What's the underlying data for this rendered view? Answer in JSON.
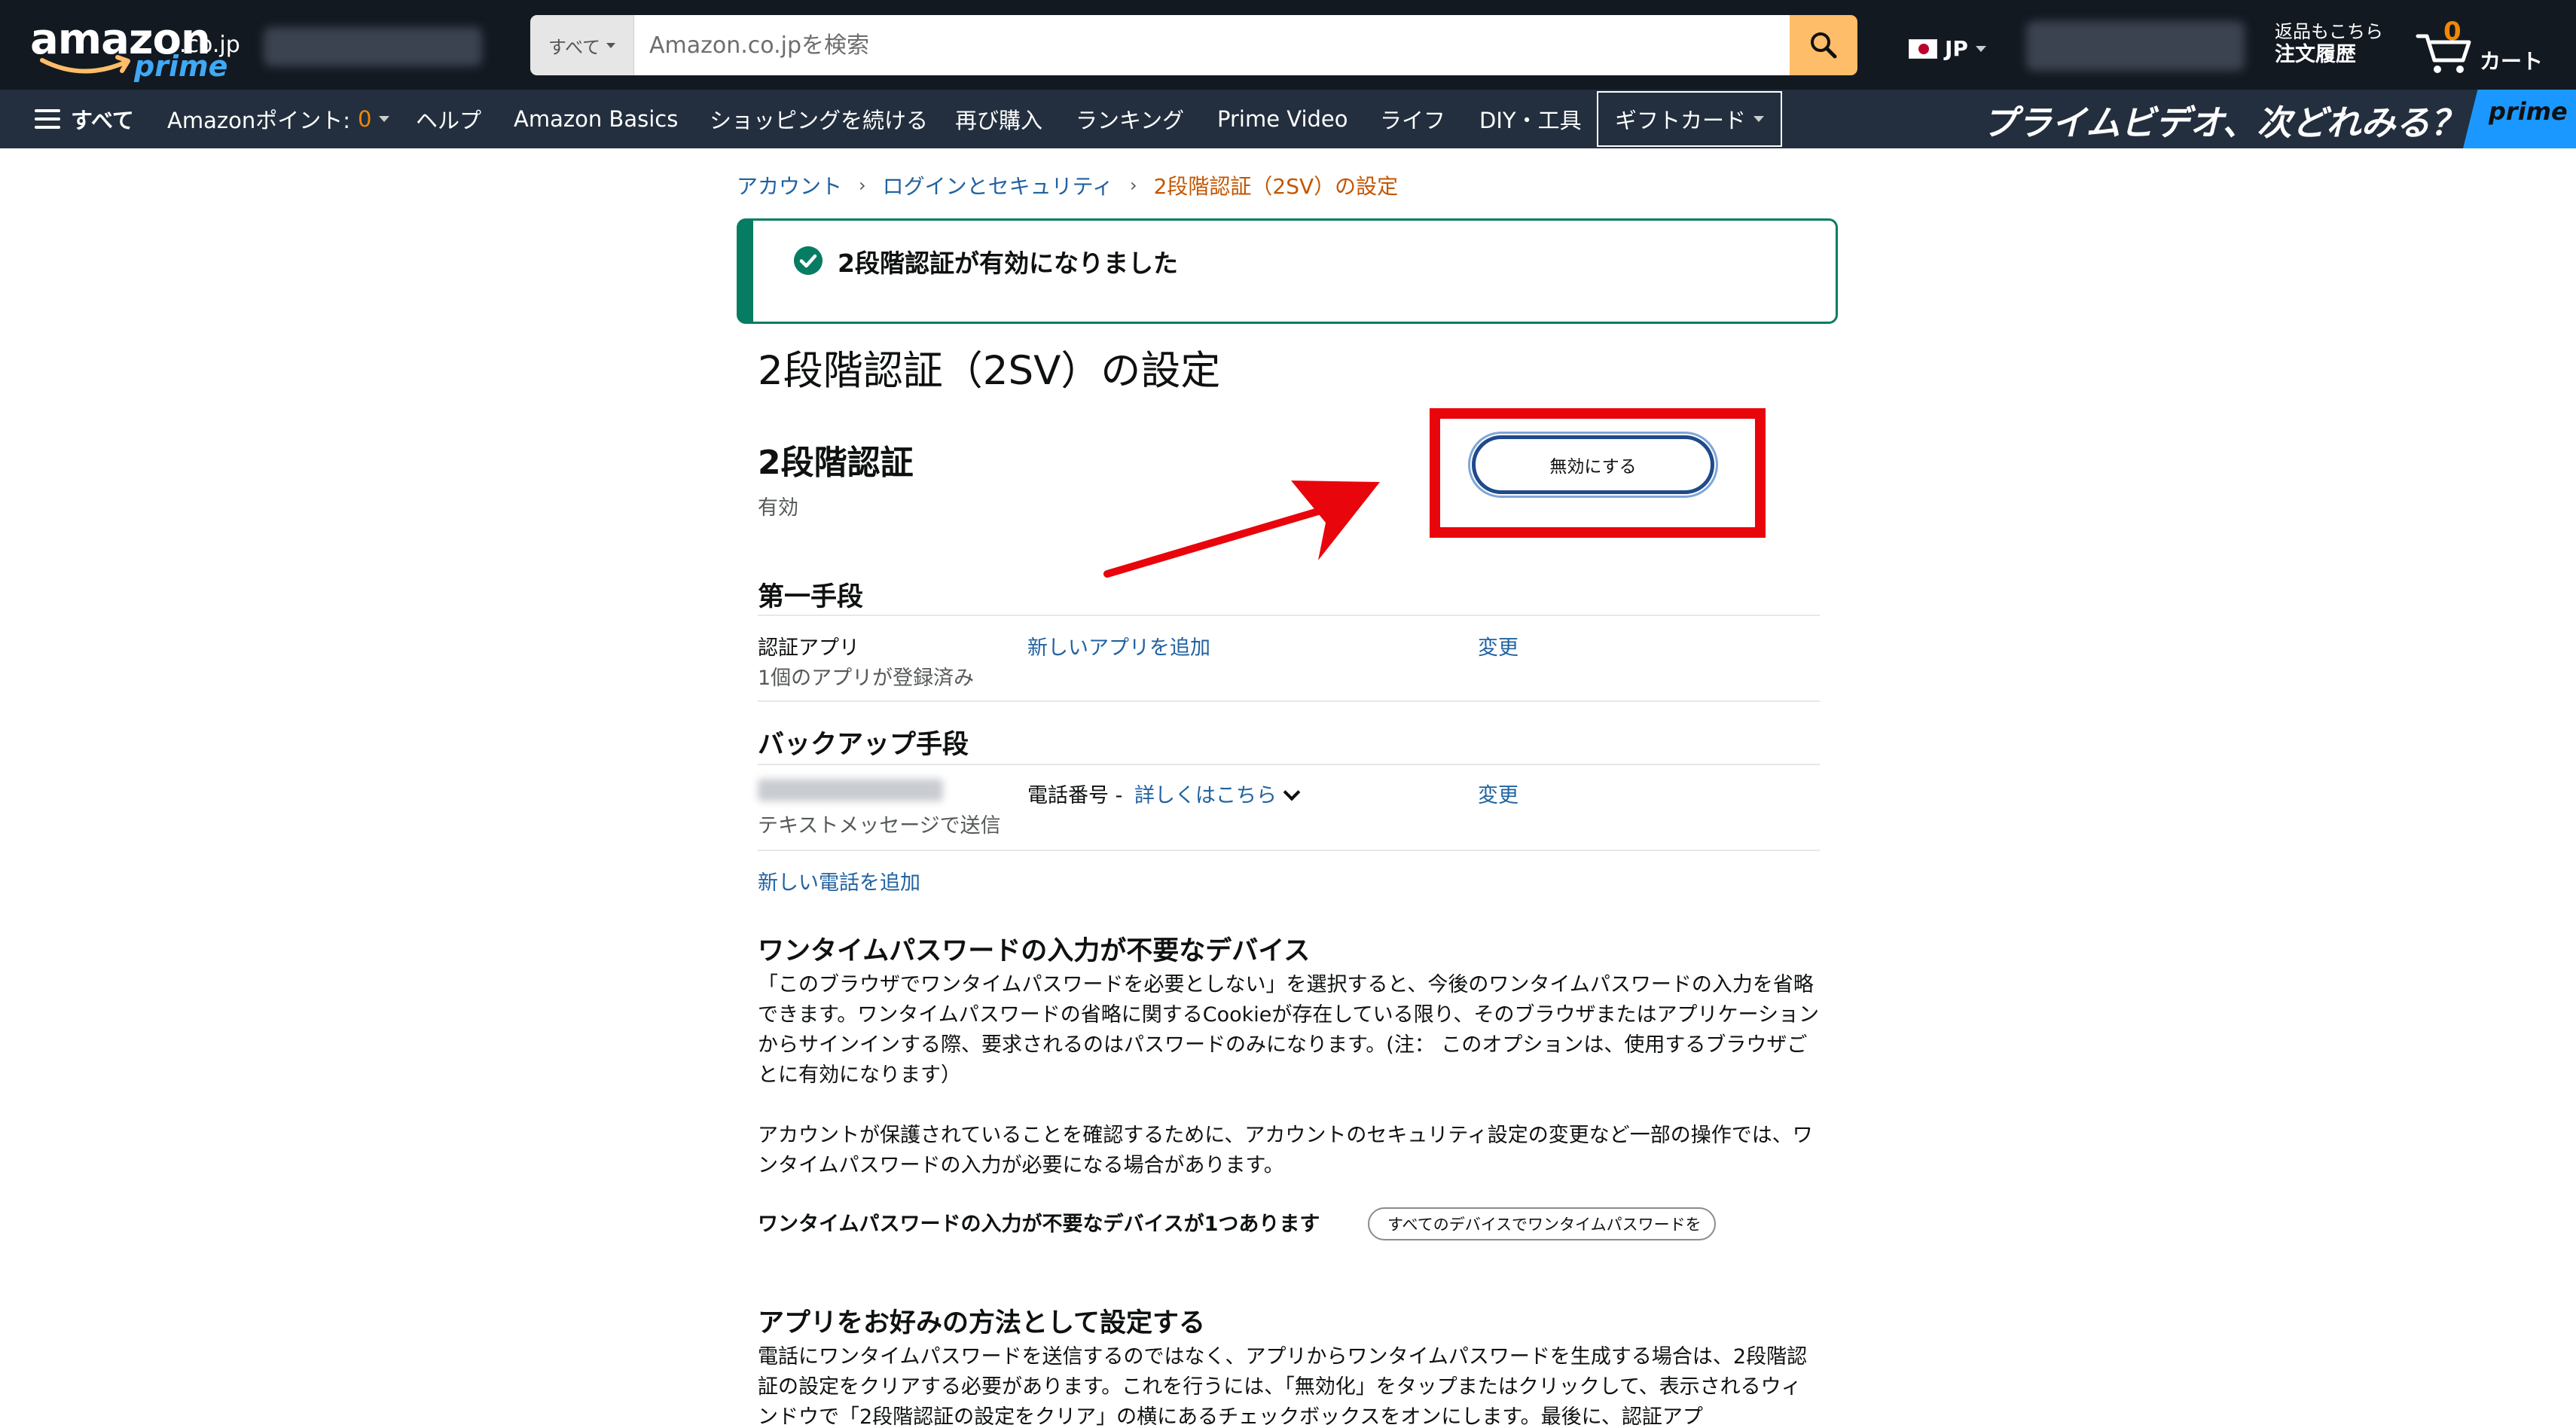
{
  "header": {
    "logo_text": "amazon",
    "logo_tld": ".co.jp",
    "logo_prime": "prime",
    "search_category": "すべて",
    "search_placeholder": "Amazon.co.jpを検索",
    "language": "JP",
    "orders_small": "返品もこちら",
    "orders_big": "注文履歴",
    "cart_count": "0",
    "cart_label": "カート"
  },
  "subnav": {
    "all": "すべて",
    "points_label": "Amazonポイント:",
    "points_value": "0",
    "items": [
      "ヘルプ",
      "Amazon Basics",
      "ショッピングを続ける",
      "再び購入",
      "ランキング",
      "Prime Video",
      "ライフ",
      "DIY・工具"
    ],
    "gift": "ギフトカード",
    "ad_text": "プライムビデオ、次どれみる？",
    "ad_logo": "prime"
  },
  "breadcrumb": {
    "account": "アカウント",
    "login_security": "ログインとセキュリティ",
    "current": "2段階認証（2SV）の設定"
  },
  "alert": {
    "message": "2段階認証が有効になりました"
  },
  "page": {
    "title": "2段階認証（2SV）の設定",
    "section_title": "2段階認証",
    "status": "有効",
    "disable_button": "無効にする"
  },
  "primary": {
    "heading": "第一手段",
    "label": "認証アプリ",
    "sub": "1個のアプリが登録済み",
    "add_link": "新しいアプリを追加",
    "change": "変更"
  },
  "backup": {
    "heading": "バックアップ手段",
    "sub": "テキストメッセージで送信",
    "phone_label": "電話番号 -",
    "details_link": "詳しくはこちら",
    "change": "変更",
    "add_phone": "新しい電話を追加"
  },
  "otp_devices": {
    "heading": "ワンタイムパスワードの入力が不要なデバイス",
    "para1": "「このブラウザでワンタイムパスワードを必要としない」を選択すると、今後のワンタイムパスワードの入力を省略できます。ワンタイムパスワードの省略に関するCookieが存在している限り、そのブラウザまたはアプリケーションからサインインする際、要求されるのはパスワードのみになります。(注： このオプションは、使用するブラウザごとに有効になります）",
    "para2": "アカウントが保護されていることを確認するために、アカウントのセキュリティ設定の変更など一部の操作では、ワンタイムパスワードの入力が必要になる場合があります。",
    "count": "ワンタイムパスワードの入力が不要なデバイスが1つあります",
    "button": "すべてのデバイスでワンタイムパスワードを"
  },
  "app_pref": {
    "heading": "アプリをお好みの方法として設定する",
    "para": "電話にワンタイムパスワードを送信するのではなく、アプリからワンタイムパスワードを生成する場合は、2段階認証の設定をクリアする必要があります。これを行うには、「無効化」をタップまたはクリックして、表示されるウィンドウで「2段階認証の設定をクリア」の横にあるチェックボックスをオンにします。最後に、認証アプ"
  },
  "colors": {
    "nav_dark": "#131921",
    "nav_sub": "#232f3e",
    "search_button": "#febd69",
    "link": "#2162a1",
    "breadcrumb_current": "#c45500",
    "success": "#067d62",
    "highlight_red": "#e8050b",
    "prime_blue": "#1a98ff"
  },
  "icons": [
    "search-icon",
    "cart-icon",
    "hamburger-icon",
    "check-circle-icon",
    "flag-jp-icon",
    "chevron-down-icon",
    "red-arrow-annotation"
  ]
}
